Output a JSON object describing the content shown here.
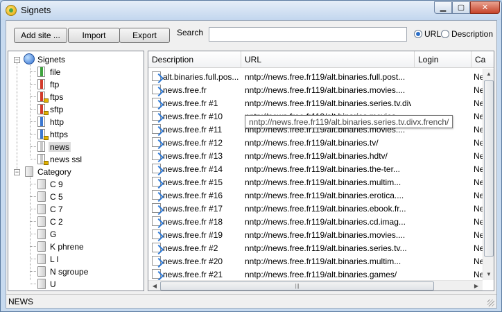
{
  "window": {
    "title": "Signets"
  },
  "titlebar": {
    "min": "▁",
    "max": "▢",
    "close": "✕"
  },
  "toolbar": {
    "add_site": "Add site ...",
    "import": "Import",
    "export": "Export",
    "search_label": "Search",
    "search_value": "",
    "radio_url": "URL",
    "radio_description": "Description",
    "selected_radio": "URL"
  },
  "tree": {
    "root": "Signets",
    "protocols": [
      "file",
      "ftp",
      "ftps",
      "sftp",
      "http",
      "https",
      "news",
      "news ssl"
    ],
    "category_root": "Category",
    "categories": [
      "C    9",
      "C    5",
      "C    7",
      "C    2",
      "G",
      "K      phrene",
      "L      l",
      "N      sgroupe",
      "U"
    ]
  },
  "grid": {
    "columns": [
      "Description",
      "URL",
      "Login",
      "Ca"
    ],
    "rows": [
      {
        "desc": "alt.binaries.full.pos...",
        "url": "nntp://news.free.fr119/alt.binaries.full.post...",
        "cat": "Ne"
      },
      {
        "desc": "news.free.fr",
        "url": "nntp://news.free.fr119/alt.binaries.movies....",
        "cat": "Ne"
      },
      {
        "desc": "news.free.fr #1",
        "url": "nntp://news.free.fr119/alt.binaries.series.tv.divx.french/",
        "cat": "Ne"
      },
      {
        "desc": "news.free.fr #10",
        "url": "nntp://news.free.fr119/alt.binaries.movies....",
        "cat": "Ne"
      },
      {
        "desc": "news.free.fr #11",
        "url": "nntp://news.free.fr119/alt.binaries.movies....",
        "cat": "Ne"
      },
      {
        "desc": "news.free.fr #12",
        "url": "nntp://news.free.fr119/alt.binaries.tv/",
        "cat": "Ne"
      },
      {
        "desc": "news.free.fr #13",
        "url": "nntp://news.free.fr119/alt.binaries.hdtv/",
        "cat": "Ne"
      },
      {
        "desc": "news.free.fr #14",
        "url": "nntp://news.free.fr119/alt.binaries.the-ter...",
        "cat": "Ne"
      },
      {
        "desc": "news.free.fr #15",
        "url": "nntp://news.free.fr119/alt.binaries.multim...",
        "cat": "Ne"
      },
      {
        "desc": "news.free.fr #16",
        "url": "nntp://news.free.fr119/alt.binaries.erotica....",
        "cat": "Ne"
      },
      {
        "desc": "news.free.fr #17",
        "url": "nntp://news.free.fr119/alt.binaries.ebook.fr...",
        "cat": "Ne"
      },
      {
        "desc": "news.free.fr #18",
        "url": "nntp://news.free.fr119/alt.binaries.cd.imag...",
        "cat": "Ne"
      },
      {
        "desc": "news.free.fr #19",
        "url": "nntp://news.free.fr119/alt.binaries.movies....",
        "cat": "Ne"
      },
      {
        "desc": "news.free.fr #2",
        "url": "nntp://news.free.fr119/alt.binaries.series.tv...",
        "cat": "Ne"
      },
      {
        "desc": "news.free.fr #20",
        "url": "nntp://news.free.fr119/alt.binaries.multim...",
        "cat": "Ne"
      },
      {
        "desc": "news.free.fr #21",
        "url": "nntp://news.free.fr119/alt.binaries.games/",
        "cat": "Ne"
      }
    ],
    "tooltip": "nntp://news.free.fr119/alt.binaries.series.tv.divx.french/",
    "scroll_up": "▲",
    "scroll_down": "▼",
    "scroll_left": "◀",
    "scroll_right": "▶",
    "grip": "|||"
  },
  "status": {
    "text": "NEWS"
  }
}
